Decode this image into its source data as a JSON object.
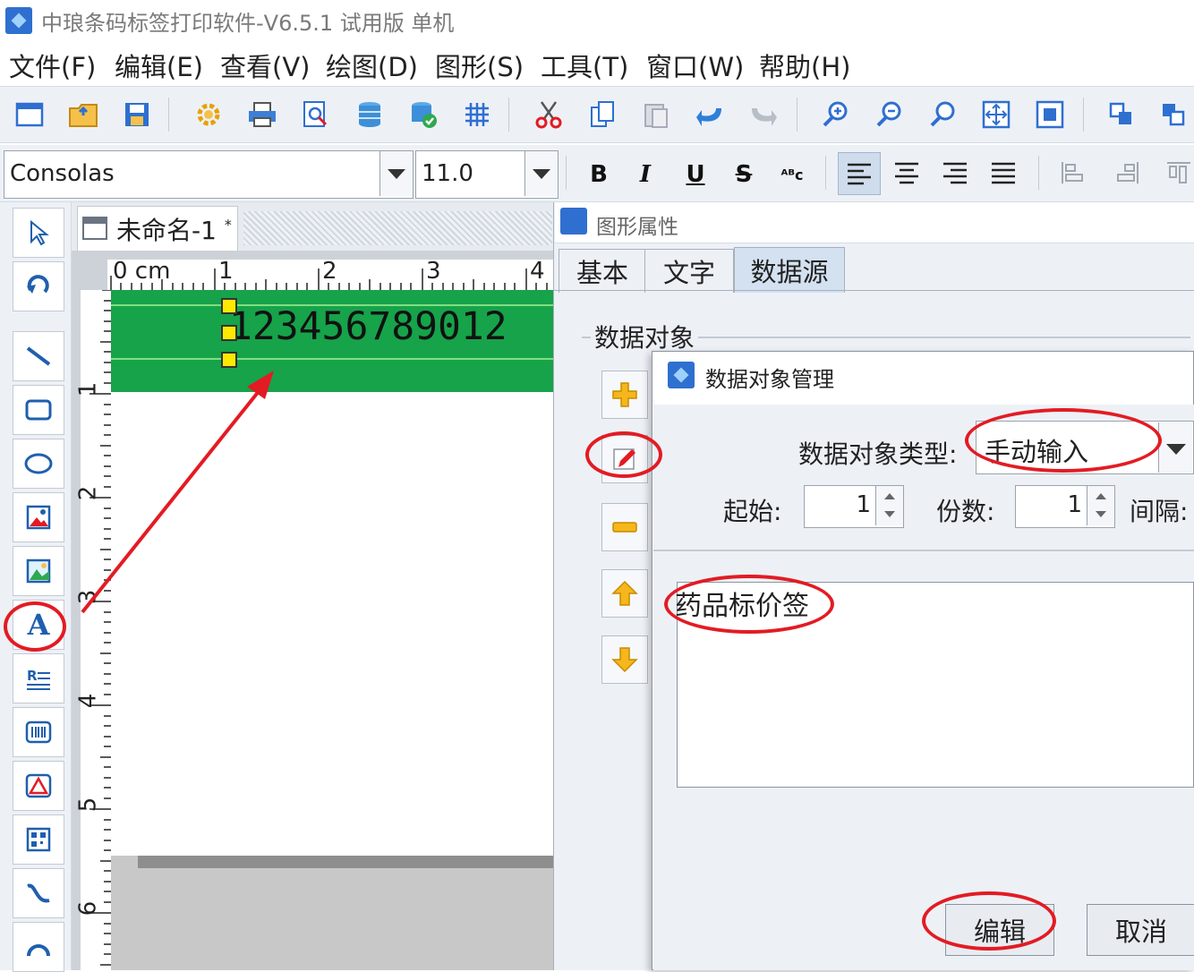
{
  "window": {
    "title": "中琅条码标签打印软件-V6.5.1 试用版 单机"
  },
  "menu": [
    {
      "label": "文件(F)"
    },
    {
      "label": "编辑(E)"
    },
    {
      "label": "查看(V)"
    },
    {
      "label": "绘图(D)"
    },
    {
      "label": "图形(S)"
    },
    {
      "label": "工具(T)"
    },
    {
      "label": "窗口(W)"
    },
    {
      "label": "帮助(H)"
    }
  ],
  "toolbar": {
    "icons": [
      "new-icon",
      "open-icon",
      "save-icon",
      "settings-icon",
      "print-icon",
      "print-preview-icon",
      "database-icon",
      "database-refresh-icon",
      "grid-icon",
      "cut-icon",
      "copy-icon",
      "paste-icon",
      "undo-icon",
      "redo-icon",
      "zoom-in-icon",
      "zoom-out-icon",
      "zoom-icon",
      "fit-page-icon",
      "fit-width-icon",
      "bring-front-icon",
      "send-back-icon"
    ]
  },
  "format": {
    "font_name": "Consolas",
    "font_size": "11.0",
    "bold": "B",
    "italic": "I",
    "underline": "U",
    "strike": "S",
    "superscript": "ᴬᴮc"
  },
  "document": {
    "tab_title": "未命名-1",
    "modified_mark": "*",
    "ruler_unit": "0 cm",
    "h_ticks": [
      "1",
      "2",
      "3",
      "4"
    ],
    "v_ticks": [
      "1",
      "2",
      "3",
      "4",
      "5",
      "6"
    ],
    "barcode_text": "123456789012",
    "band_color": "#16a34a"
  },
  "properties": {
    "title": "图形属性",
    "tabs": [
      {
        "label": "基本"
      },
      {
        "label": "文字"
      },
      {
        "label": "数据源"
      }
    ],
    "active_tab": "数据源",
    "group_label": "数据对象"
  },
  "dialog": {
    "title": "数据对象管理",
    "type_label": "数据对象类型:",
    "type_value": "手动输入",
    "start_label": "起始:",
    "start_value": "1",
    "copies_label": "份数:",
    "copies_value": "1",
    "interval_label": "间隔:",
    "content": "药品标价签",
    "edit_button": "编辑",
    "cancel_button": "取消"
  },
  "annotation_color": "#e31b23"
}
